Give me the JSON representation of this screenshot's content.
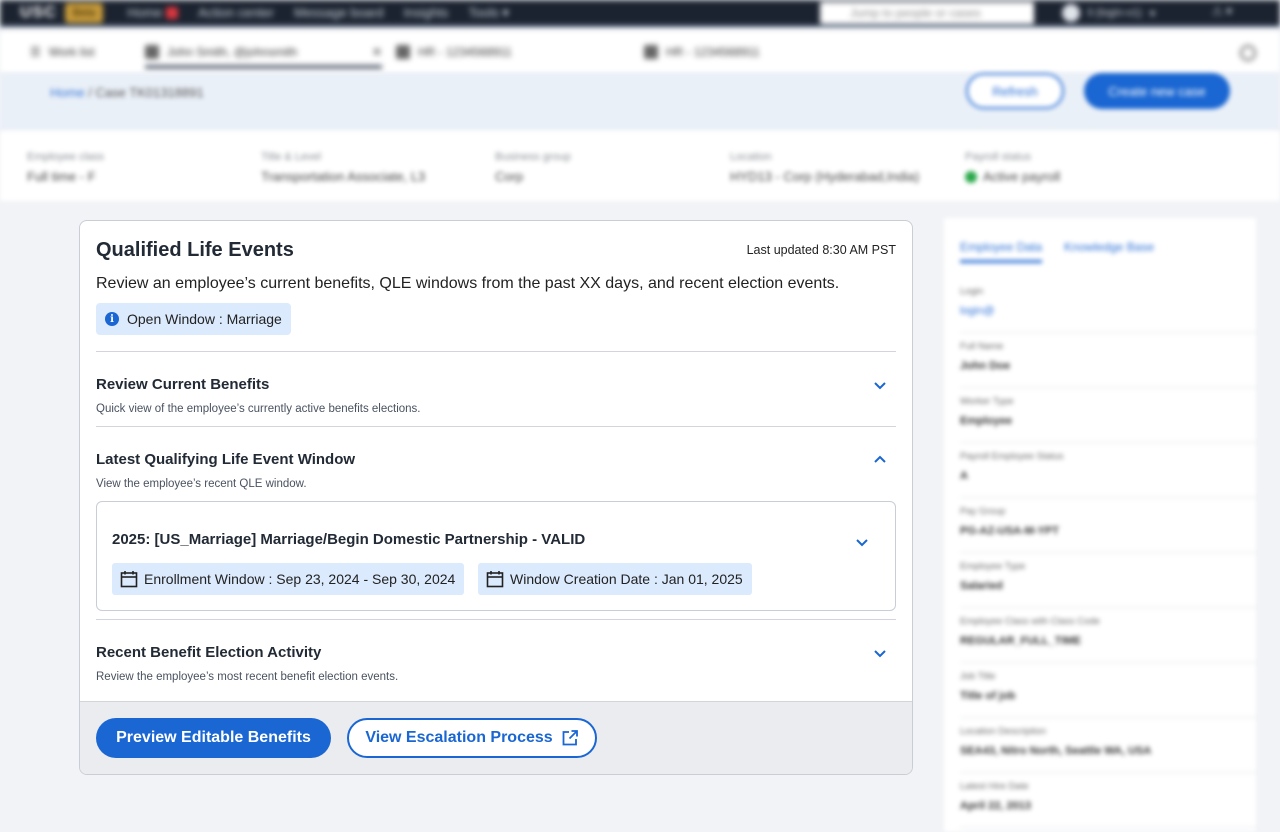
{
  "topnav": {
    "logo": "USC",
    "badge": "Beta",
    "items": [
      "Home",
      "Action center",
      "Message board",
      "Insights",
      "Tools"
    ],
    "search_placeholder": "Jump to people or cases",
    "user": "li (login-v1)"
  },
  "tabs": [
    {
      "label": "Work list"
    },
    {
      "label": "John Smith, @johnsmith"
    },
    {
      "label": "HR - 1234568911"
    },
    {
      "label": "HR - 1234568911"
    }
  ],
  "subheader": {
    "crumb_home": "Home",
    "crumb_current": " / Case TK01318891",
    "refresh_label": "Refresh",
    "create_label": "Create new case"
  },
  "infostrip": [
    {
      "label": "Employee class",
      "value": "Full time - F"
    },
    {
      "label": "Title & Level",
      "value": "Transportation Associate, L3"
    },
    {
      "label": "Business group",
      "value": "Corp"
    },
    {
      "label": "Location",
      "value": "HYD13 - Corp (Hyderabad,India)"
    },
    {
      "label": "Payroll status",
      "value": "Active payroll"
    }
  ],
  "card": {
    "title": "Qualified Life Events",
    "last_updated": "Last updated 8:30 AM PST",
    "description": "Review an employee’s current benefits, QLE windows from the past XX days, and recent election events.",
    "open_window": "Open Window : Marriage",
    "sections": [
      {
        "title": "Review Current Benefits",
        "subtitle": "Quick view of the employee’s currently active benefits elections."
      },
      {
        "title": "Latest Qualifying Life Event Window",
        "subtitle": "View the employee’s recent QLE window."
      },
      {
        "title": "Recent Benefit Election Activity",
        "subtitle": "Review the employee’s most recent benefit election events."
      }
    ],
    "qle": {
      "title": "2025: [US_Marriage] Marriage/Begin Domestic Partnership - VALID",
      "enrollment_window": "Enrollment Window : Sep 23, 2024 - Sep 30, 2024",
      "window_creation": "Window Creation Date : Jan 01, 2025"
    },
    "preview_button": "Preview Editable Benefits",
    "escalation_button": "View Escalation Process"
  },
  "rpanel": {
    "tabs": [
      "Employee Data",
      "Knowledge Base"
    ],
    "fields": [
      {
        "label": "Login",
        "value": "login@"
      },
      {
        "label": "Full Name",
        "value": "John Doe"
      },
      {
        "label": "Worker Type",
        "value": "Employee"
      },
      {
        "label": "Payroll Employee Status",
        "value": "A"
      },
      {
        "label": "Pay Group",
        "value": "PG-AZ-USA-M-YPT"
      },
      {
        "label": "Employee Type",
        "value": "Salaried"
      },
      {
        "label": "Employee Class with Class Code",
        "value": "REGULAR_FULL_TIME"
      },
      {
        "label": "Job Title",
        "value": "Title of job"
      },
      {
        "label": "Location Description",
        "value": "SEA43, Nitro North, Seattle WA, USA"
      },
      {
        "label": "Latest Hire Date",
        "value": "April 22, 2013"
      }
    ]
  }
}
